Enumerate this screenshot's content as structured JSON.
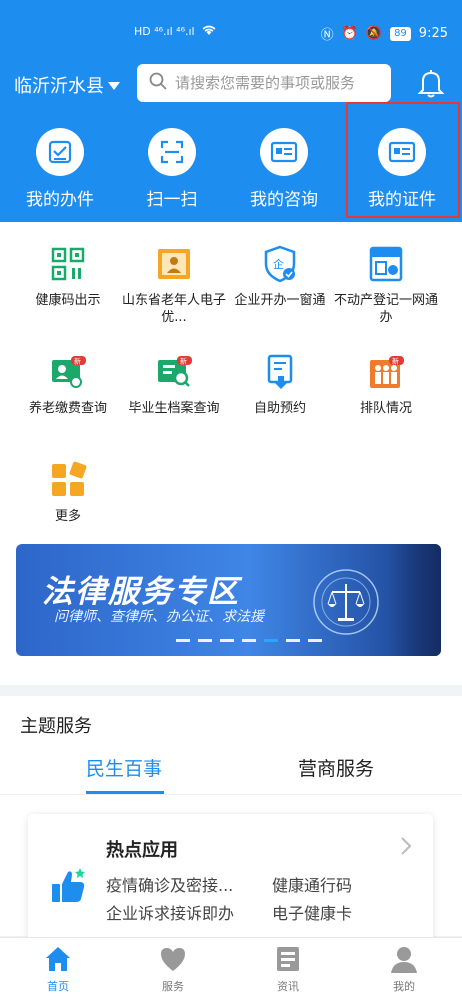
{
  "status_bar": {
    "left_icons": "HD ⁴⁶.ıl ⁴⁶.ıl",
    "time": "9:25",
    "battery": "89"
  },
  "header": {
    "location": "临沂沂水县",
    "search_placeholder": "请搜索您需要的事项或服务"
  },
  "quick_actions": [
    {
      "label": "我的办件",
      "icon": "document-check-icon"
    },
    {
      "label": "扫一扫",
      "icon": "scan-icon"
    },
    {
      "label": "我的咨询",
      "icon": "consult-card-icon"
    },
    {
      "label": "我的证件",
      "icon": "id-card-icon"
    }
  ],
  "services": [
    {
      "label": "健康码出示",
      "icon": "qr-code-icon"
    },
    {
      "label": "山东省老年人电子优...",
      "icon": "senior-card-icon"
    },
    {
      "label": "企业开办一窗通",
      "icon": "enterprise-shield-icon"
    },
    {
      "label": "不动产登记一网通办",
      "icon": "property-icon"
    },
    {
      "label": "养老缴费查询",
      "icon": "pension-icon",
      "badge": "新"
    },
    {
      "label": "毕业生档案查询",
      "icon": "graduate-archive-icon",
      "badge": "新"
    },
    {
      "label": "自助预约",
      "icon": "self-appointment-icon"
    },
    {
      "label": "排队情况",
      "icon": "queue-icon",
      "badge": "新"
    },
    {
      "label": "更多",
      "icon": "more-grid-icon"
    }
  ],
  "banner": {
    "title": "法律服务专区",
    "subtitle": "问律师、查律所、办公证、求法援"
  },
  "theme": {
    "title": "主题服务",
    "tabs": [
      "民生百事",
      "营商服务"
    ],
    "active_tab": 0,
    "card": {
      "title": "热点应用",
      "links": [
        "疫情确诊及密接...",
        "健康通行码",
        "企业诉求接诉即办",
        "电子健康卡"
      ]
    }
  },
  "bottom_nav": [
    {
      "label": "首页",
      "icon": "home-icon",
      "active": true
    },
    {
      "label": "服务",
      "icon": "heart-icon",
      "active": false
    },
    {
      "label": "资讯",
      "icon": "news-icon",
      "active": false
    },
    {
      "label": "我的",
      "icon": "user-icon",
      "active": false
    }
  ],
  "colors": {
    "primary": "#1d8ef0",
    "accent_red": "#e53935",
    "service_green": "#1aa86b",
    "service_orange": "#f5a623"
  }
}
